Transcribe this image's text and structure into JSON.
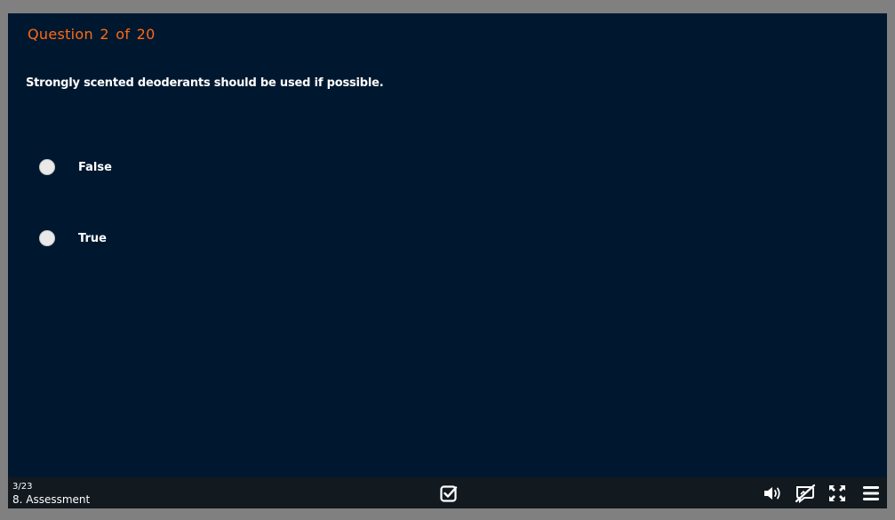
{
  "question": {
    "label": "Question",
    "number": "2",
    "of_label": "of",
    "total": "20",
    "text": "Strongly scented deoderants should be used if possible."
  },
  "options": [
    {
      "label": "False"
    },
    {
      "label": "True"
    }
  ],
  "bottombar": {
    "slide_count": "3/23",
    "section_title": "8. Assessment",
    "icons": {
      "submit": "checkbox-check-icon",
      "volume": "volume-icon",
      "captions": "captions-off-icon",
      "fullscreen": "fullscreen-icon",
      "menu": "menu-icon"
    }
  },
  "colors": {
    "background": "#00182f",
    "accent": "#ff6a13",
    "bar": "#12191f",
    "frame": "#808080"
  }
}
